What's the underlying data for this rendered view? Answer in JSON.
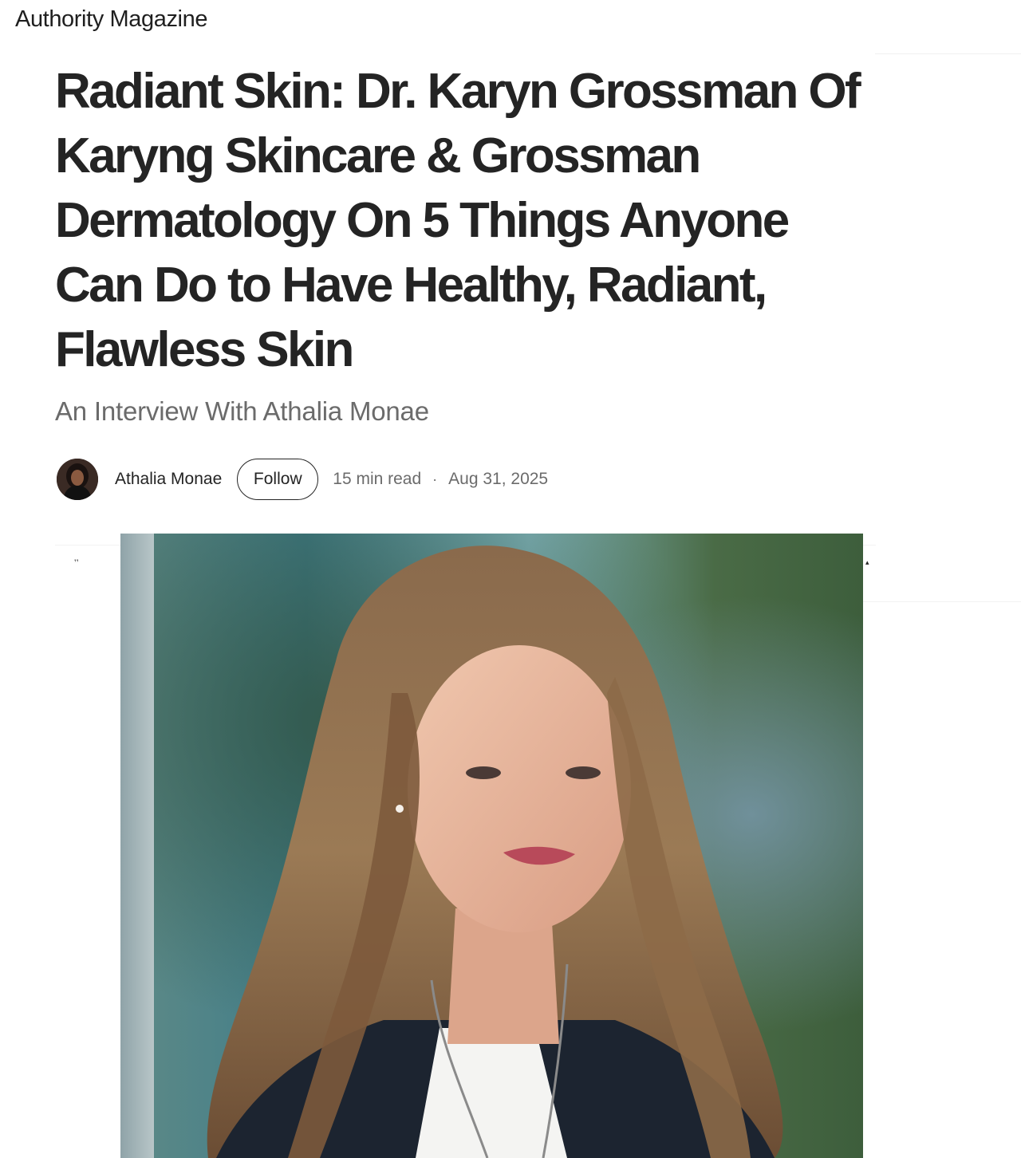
{
  "publication": {
    "name": "Authority Magazine"
  },
  "article": {
    "title": "Radiant Skin: Dr. Karyn Grossman Of Karyng Skincare & Grossman Dermatology On 5 Things Anyone Can Do to Have Healthy, Radiant, Flawless Skin",
    "subtitle": "An Interview With Athalia Monae"
  },
  "author": {
    "name": "Athalia Monae",
    "follow_label": "Follow"
  },
  "meta": {
    "read_time": "15 min read",
    "separator": "·",
    "date": "Aug 31, 2025"
  },
  "icons": {
    "clap": "clap-icon",
    "share": "share-icon"
  },
  "colors": {
    "text_primary": "#242424",
    "text_secondary": "#6b6b6b",
    "divider": "#f2f2f2"
  }
}
